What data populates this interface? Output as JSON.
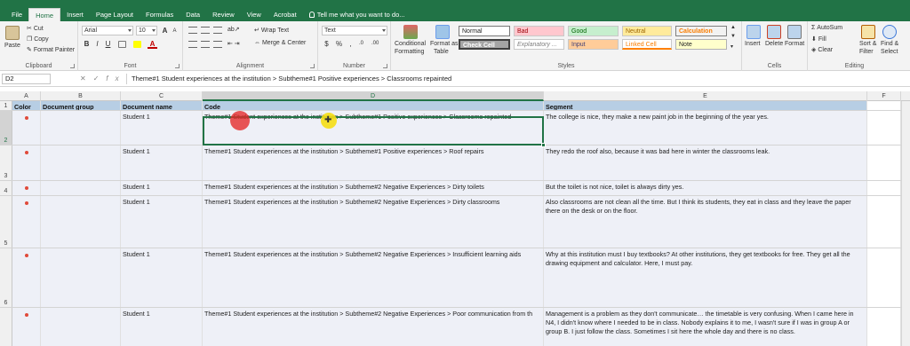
{
  "ribbon": {
    "tabs": [
      "File",
      "Home",
      "Insert",
      "Page Layout",
      "Formulas",
      "Data",
      "Review",
      "View",
      "Acrobat"
    ],
    "active_tab": "Home",
    "tell_me": "Tell me what you want to do...",
    "clipboard": {
      "paste": "Paste",
      "cut": "Cut",
      "copy": "Copy",
      "format_painter": "Format Painter",
      "label": "Clipboard"
    },
    "font": {
      "name": "Arial",
      "size": "10",
      "bold": "B",
      "italic": "I",
      "underline": "U",
      "grow": "A",
      "shrink": "A",
      "color": "A",
      "label": "Font"
    },
    "alignment": {
      "wrap_text": "Wrap Text",
      "merge_center": "Merge & Center",
      "label": "Alignment"
    },
    "number": {
      "format": "Text",
      "currency": "$",
      "percent": "%",
      "comma": ",",
      "dec_up": ".0",
      "dec_down": ".00",
      "label": "Number"
    },
    "styles": {
      "conditional": "Conditional",
      "conditional2": "Formatting",
      "format_as": "Format as",
      "format_as2": "Table",
      "cells": [
        "Normal",
        "Bad",
        "Good",
        "Neutral",
        "Calculation",
        "Check Cell",
        "Explanatory ...",
        "Input",
        "Linked Cell",
        "Note"
      ],
      "label": "Styles"
    },
    "cells_group": {
      "insert": "Insert",
      "delete": "Delete",
      "format": "Format",
      "label": "Cells"
    },
    "editing": {
      "autosum": "AutoSum",
      "fill": "Fill",
      "clear": "Clear",
      "sort_filter": "Sort &",
      "sort_filter2": "Filter",
      "find_select": "Find &",
      "find_select2": "Select",
      "label": "Editing"
    }
  },
  "formula_bar": {
    "name_box": "D2",
    "cancel": "✕",
    "enter": "✓",
    "fx": "fx",
    "content": "Theme#1 Student experiences at the institution > Subtheme#1 Positive experiences > Classrooms repainted"
  },
  "columns": [
    "A",
    "B",
    "C",
    "D",
    "E",
    "F"
  ],
  "selected_column": "D",
  "selected_row": "2",
  "header_row": {
    "row_num": "1",
    "color": "Color",
    "document_group": "Document group",
    "document_name": "Document name",
    "code": "Code",
    "segment": "Segment"
  },
  "rows": [
    {
      "row_num": "2",
      "document_name": "Student 1",
      "code": "Theme#1 Student experiences at the institution > Subtheme#1 Positive experiences > Classrooms repainted",
      "segment": "The college is nice, they make a new paint job in the beginning of the year yes."
    },
    {
      "row_num": "3",
      "document_name": "Student 1",
      "code": "Theme#1 Student experiences at the institution > Subtheme#1 Positive experiences > Roof repairs",
      "segment": "They redo the roof also, because it was bad here in winter the classrooms leak."
    },
    {
      "row_num": "4",
      "document_name": "Student 1",
      "code": "Theme#1 Student experiences at the institution > Subtheme#2 Negative Experiences > Dirty toilets",
      "segment": "But the toilet is not nice, toilet is always dirty yes."
    },
    {
      "row_num": "5",
      "document_name": "Student 1",
      "code": "Theme#1 Student experiences at the institution > Subtheme#2 Negative Experiences > Dirty classrooms",
      "segment": "Also classrooms are not clean all the time. But I think its students, they eat in class and they leave the paper there on the desk or on the floor."
    },
    {
      "row_num": "6",
      "document_name": "Student 1",
      "code": "Theme#1 Student experiences at the institution > Subtheme#2 Negative Experiences > Insufficient learning aids",
      "segment": "Why at this institution must I buy textbooks? At other institutions, they get textbooks for free. They get all the drawing equipment and calculator. Here, I must pay."
    },
    {
      "row_num": "",
      "document_name": "Student 1",
      "code": "Theme#1 Student experiences at the institution > Subtheme#2 Negative Experiences > Poor communication from th",
      "segment": "Management is a problem as they don't communicate… the timetable is very confusing. When I came here in N4, I didn't know where I needed to be in class. Nobody explains it to me, I wasn't sure if I was in group A or group B. I just follow the class. Sometimes I sit here the whole day and there is no class."
    }
  ]
}
